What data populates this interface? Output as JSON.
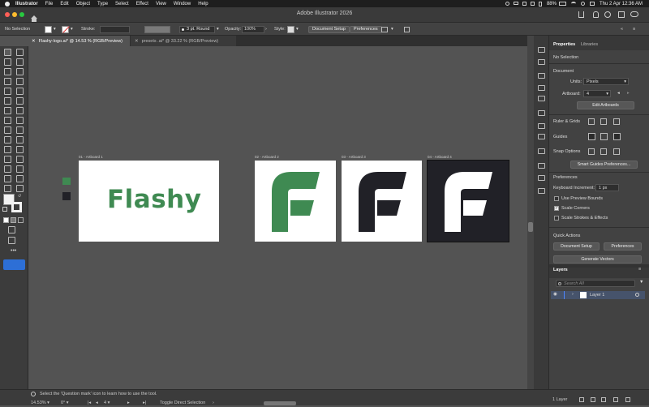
{
  "menubar": {
    "app": "Illustrator",
    "items": [
      "File",
      "Edit",
      "Object",
      "Type",
      "Select",
      "Effect",
      "View",
      "Window",
      "Help"
    ],
    "battery": "88%",
    "clock": "Thu 2 Apr  12:36 AM"
  },
  "window": {
    "title": "Adobe Illustrator 2026"
  },
  "control_bar": {
    "selection": "No Selection",
    "stroke_label": "Stroke:",
    "brush": "3 pt. Round",
    "opacity_label": "Opacity:",
    "opacity_value": "100%",
    "style_label": "Style:",
    "document_setup": "Document Setup",
    "preferences": "Preferences"
  },
  "tabs": [
    {
      "label": "Flashy-logo.ai* @ 14.53 % (RGB/Preview)",
      "active": true
    },
    {
      "label": "presets .ai* @ 33.22 % (RGB/Preview)",
      "active": false
    }
  ],
  "artboards": [
    {
      "label": "01 - Artboard 1",
      "content": "Flashy"
    },
    {
      "label": "02 - Artboard 2"
    },
    {
      "label": "03 - Artboard 3"
    },
    {
      "label": "04 - Artboard 4"
    }
  ],
  "colors": {
    "brand_green": "#3f8a52",
    "dark": "#212127",
    "white": "#ffffff"
  },
  "panel": {
    "tabs": [
      "Properties",
      "Libraries"
    ],
    "selection": "No Selection",
    "document_heading": "Document",
    "units_label": "Units:",
    "units_value": "Pixels",
    "artboard_label": "Artboard:",
    "artboard_value": "4",
    "edit_artboards": "Edit Artboards",
    "ruler_grids": "Ruler & Grids",
    "guides": "Guides",
    "snap_options": "Snap Options",
    "smart_guides_prefs": "Smart Guides Preferences...",
    "preferences_heading": "Preferences",
    "keyboard_increment_label": "Keyboard Increment:",
    "keyboard_increment_value": "1 px",
    "use_preview_bounds": "Use Preview Bounds",
    "scale_corners": "Scale Corners",
    "scale_strokes": "Scale Strokes & Effects",
    "quick_actions": "Quick Actions",
    "document_setup": "Document Setup",
    "preferences": "Preferences",
    "generate_vectors": "Generate Vectors"
  },
  "layers": {
    "title": "Layers",
    "search_placeholder": "Search All",
    "items": [
      {
        "name": "Layer 1"
      }
    ],
    "count": "1 Layer"
  },
  "status": {
    "zoom": "14.53%",
    "rotation": "0°",
    "artboard": "4",
    "hint": "Select the 'Question mark' icon to learn how to use the tool.",
    "tool": "Toggle Direct Selection"
  }
}
